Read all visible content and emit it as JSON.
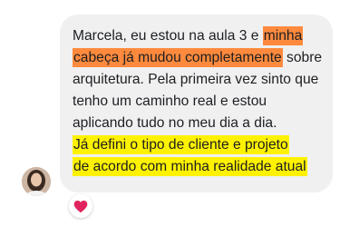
{
  "message": {
    "lines": [
      {
        "plain": "Marcela, eu estou na aula 3 e ",
        "highlight": "minha"
      },
      {
        "highlight": "cabeça já mudou completamente",
        "plain": " sobre"
      },
      {
        "plain": "arquitetura. Pela primeira vez sinto que"
      },
      {
        "plain": "tenho um caminho real e estou"
      },
      {
        "plain": "aplicando tudo no meu dia a dia."
      },
      {
        "highlight": "Já defini o tipo de cliente e projeto"
      },
      {
        "highlight": "de acordo com minha realidade atual"
      }
    ],
    "highlight_colors": {
      "orange": "#ff8a3d",
      "yellow": "#fff200"
    }
  },
  "reaction": {
    "icon": "heart-icon",
    "color": "#e0245e"
  },
  "sender": {
    "avatar": "avatar-photo"
  }
}
